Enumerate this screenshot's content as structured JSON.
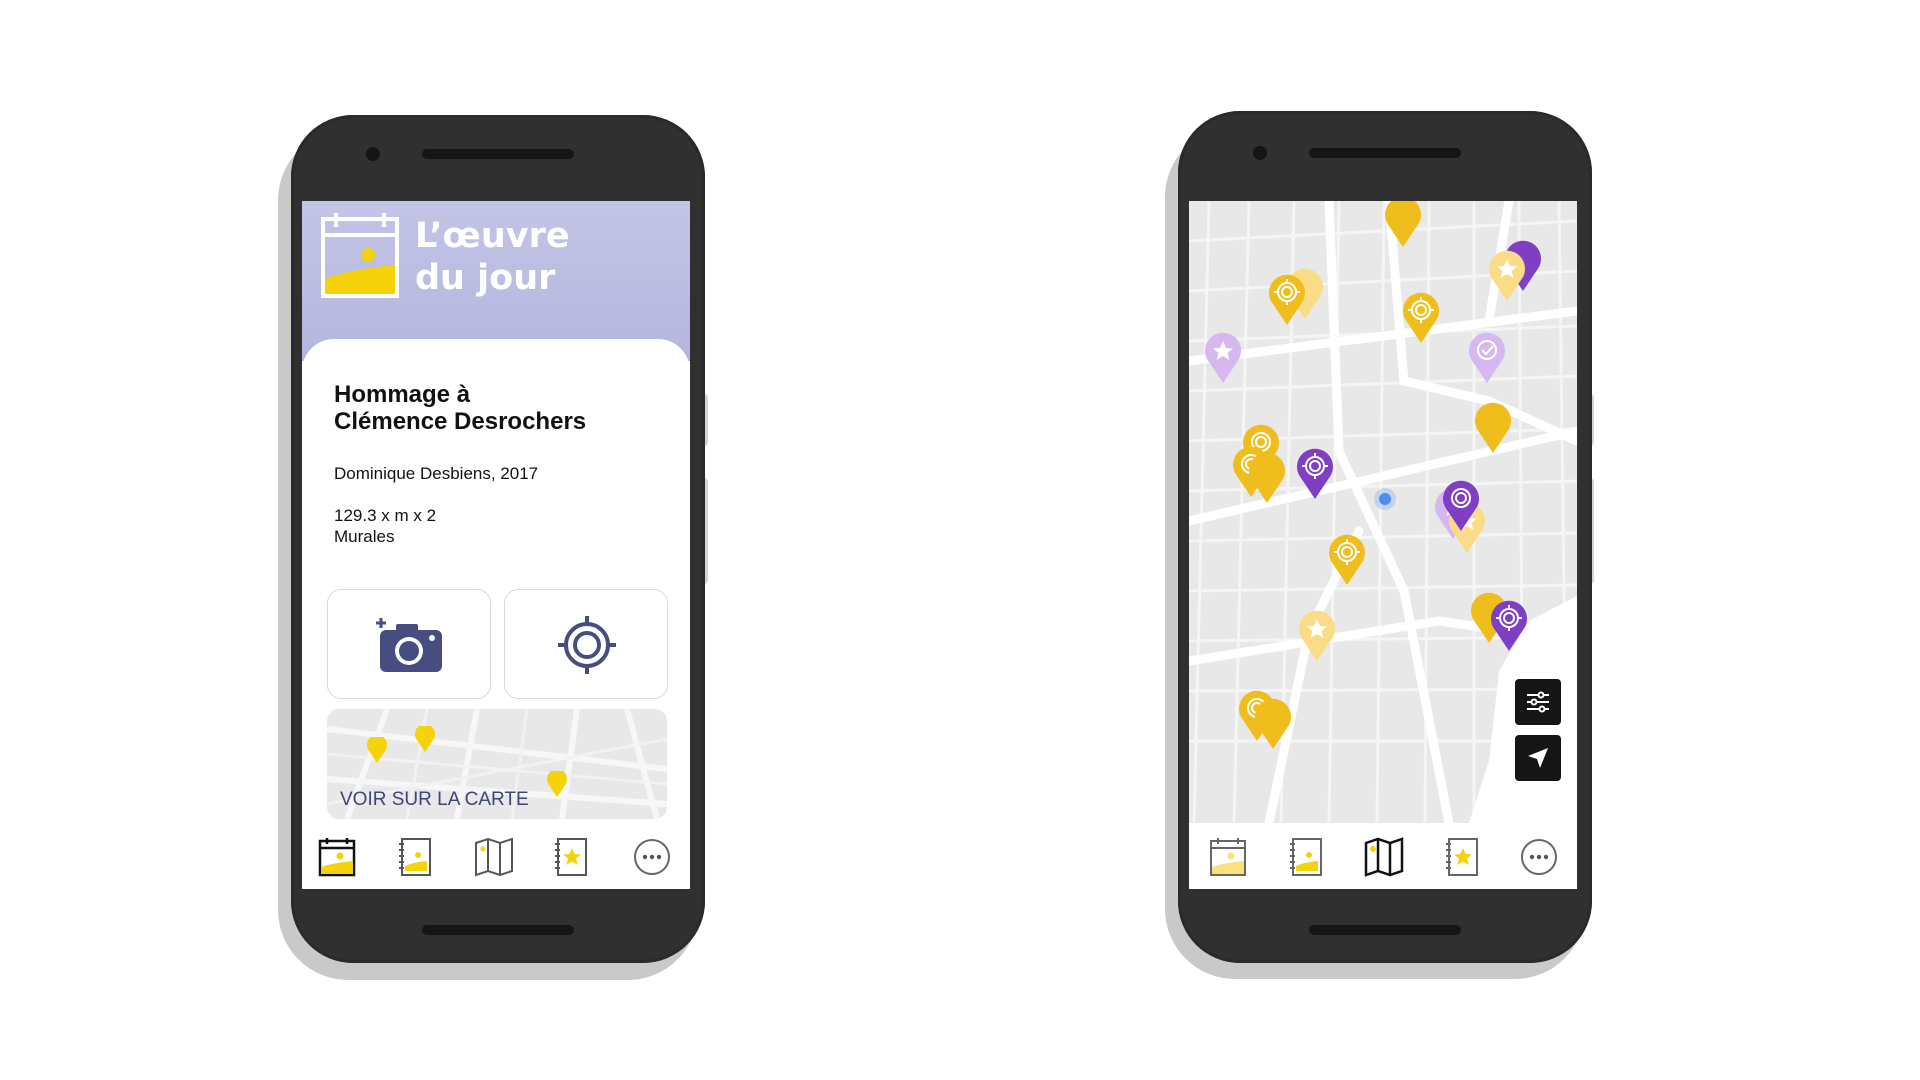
{
  "left_app": {
    "header": {
      "title": "L’œuvre\ndu jour",
      "icon": "calendar-landscape-icon"
    },
    "artwork": {
      "title": "Hommage à\nClémence Desrochers",
      "artist_year": "Dominique Desbiens, 2017",
      "dimensions": "129.3 x m x 2",
      "category": "Murales"
    },
    "actions": {
      "add_photo_icon": "add-camera-icon",
      "locate_icon": "target-icon"
    },
    "mini_map": {
      "label": "VOIR SUR LA CARTE"
    }
  },
  "right_app": {
    "map": {
      "user_location": "blue-dot",
      "controls": [
        "filter-sliders-icon",
        "navigation-arrow-icon"
      ]
    }
  },
  "tabs": [
    {
      "name": "oeuvre-du-jour",
      "icon": "calendar-icon"
    },
    {
      "name": "collection",
      "icon": "notebook-image-icon"
    },
    {
      "name": "carte",
      "icon": "map-icon"
    },
    {
      "name": "favoris",
      "icon": "notebook-star-icon"
    },
    {
      "name": "plus",
      "icon": "more-icon"
    }
  ],
  "colors": {
    "header_lavender": "#bfc0e4",
    "accent_yellow": "#f5d20a",
    "pin_gold": "#f0be1c",
    "pin_light_yellow": "#fbdc86",
    "pin_purple": "#7f3fc5",
    "pin_lavender": "#d6b8f0",
    "icon_navy": "#474d80",
    "map_bg": "#e8e8e8",
    "user_blue": "#4a8ff0"
  }
}
